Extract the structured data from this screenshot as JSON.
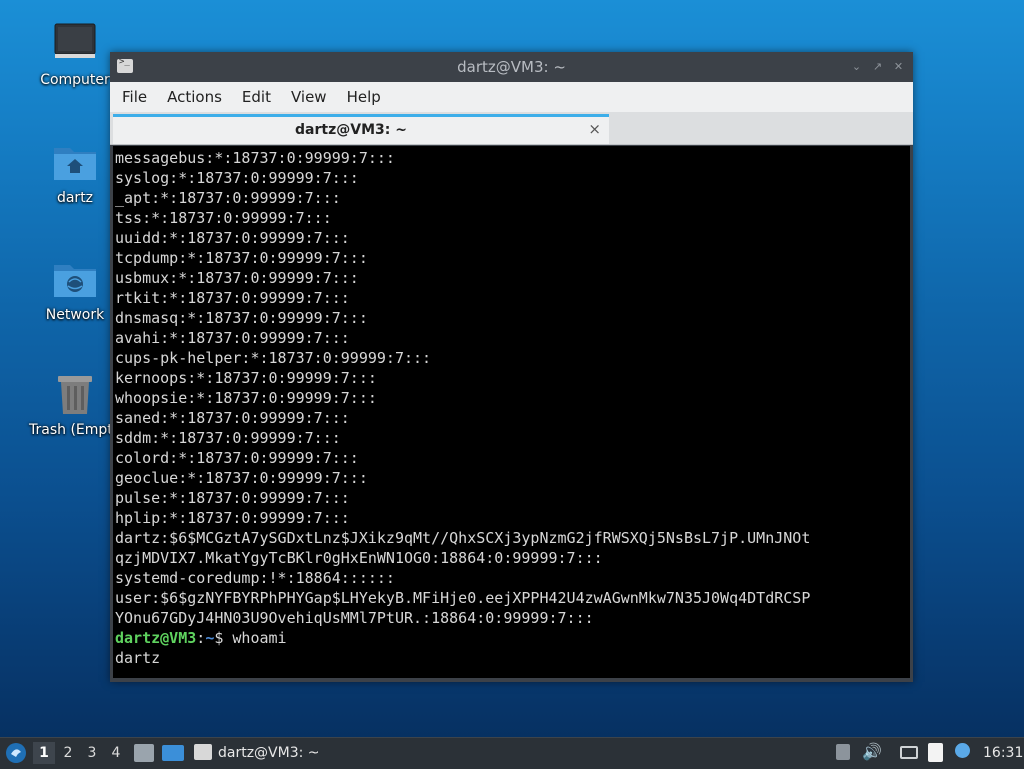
{
  "desktop": {
    "icons": [
      {
        "label": "Computer",
        "icon": "computer-icon"
      },
      {
        "label": "dartz",
        "icon": "home-folder-icon"
      },
      {
        "label": "Network",
        "icon": "network-folder-icon"
      },
      {
        "label": "Trash (Empty)",
        "icon": "trash-icon"
      }
    ]
  },
  "window": {
    "title": "dartz@VM3: ~",
    "menu": [
      "File",
      "Actions",
      "Edit",
      "View",
      "Help"
    ],
    "tab_title": "dartz@VM3: ~",
    "tab_close": "×",
    "controls": [
      "minimize",
      "maximize",
      "close"
    ]
  },
  "terminal": {
    "lines": [
      "messagebus:*:18737:0:99999:7:::",
      "syslog:*:18737:0:99999:7:::",
      "_apt:*:18737:0:99999:7:::",
      "tss:*:18737:0:99999:7:::",
      "uuidd:*:18737:0:99999:7:::",
      "tcpdump:*:18737:0:99999:7:::",
      "usbmux:*:18737:0:99999:7:::",
      "rtkit:*:18737:0:99999:7:::",
      "dnsmasq:*:18737:0:99999:7:::",
      "avahi:*:18737:0:99999:7:::",
      "cups-pk-helper:*:18737:0:99999:7:::",
      "kernoops:*:18737:0:99999:7:::",
      "whoopsie:*:18737:0:99999:7:::",
      "saned:*:18737:0:99999:7:::",
      "sddm:*:18737:0:99999:7:::",
      "colord:*:18737:0:99999:7:::",
      "geoclue:*:18737:0:99999:7:::",
      "pulse:*:18737:0:99999:7:::",
      "hplip:*:18737:0:99999:7:::",
      "dartz:$6$MCGztA7ySGDxtLnz$JXikz9qMt//QhxSCXj3ypNzmG2jfRWSXQj5NsBsL7jP.UMnJNOt",
      "qzjMDVIX7.MkatYgyTcBKlr0gHxEnWN1OG0:18864:0:99999:7:::",
      "systemd-coredump:!*:18864::::::",
      "user:$6$gzNYFBYRPhPHYGap$LHYekyB.MFiHje0.eejXPPH42U4zwAGwnMkw7N35J0Wq4DTdRCSP",
      "YOnu67GDyJ4HN03U9OvehiqUsMMl7PtUR.:18864:0:99999:7:::"
    ],
    "prompt_user": "dartz@VM3",
    "prompt_sep": ":",
    "prompt_path": "~",
    "prompt_symbol": "$ ",
    "command": "whoami",
    "output": "dartz"
  },
  "taskbar": {
    "workspaces": [
      "1",
      "2",
      "3",
      "4"
    ],
    "active_workspace": "1",
    "task_label": "dartz@VM3: ~",
    "clock": "16:31"
  }
}
